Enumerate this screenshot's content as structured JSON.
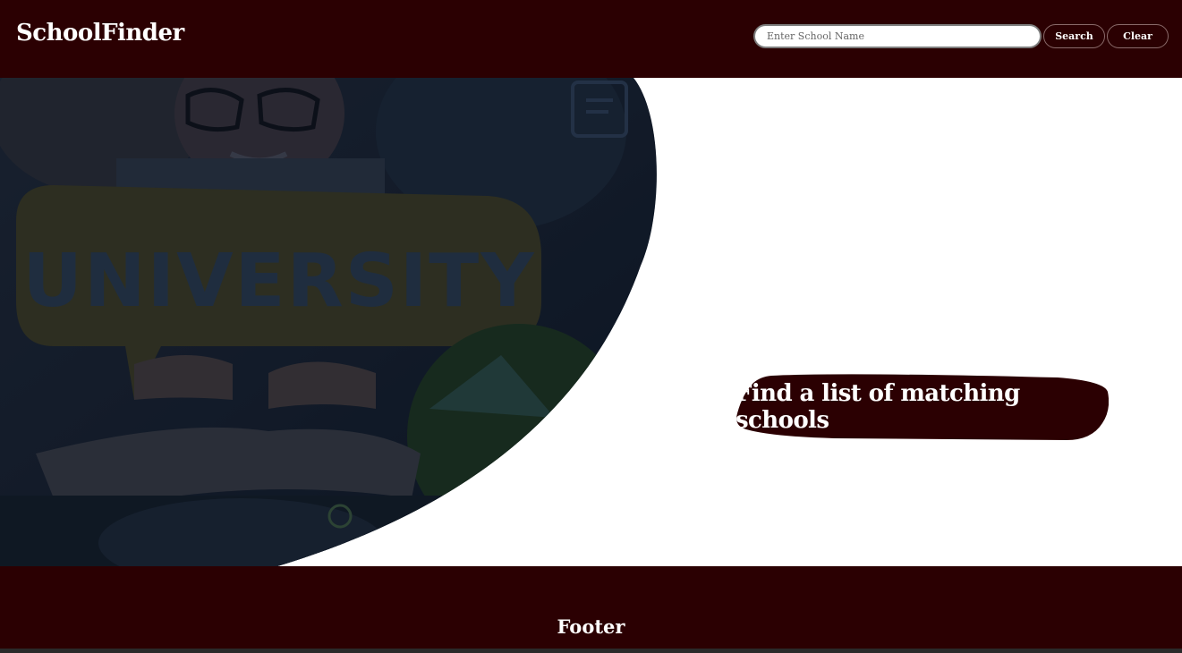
{
  "header": {
    "brand": "SchoolFinder",
    "search": {
      "placeholder": "Enter School Name",
      "value": ""
    },
    "search_label": "Search",
    "clear_label": "Clear"
  },
  "hero": {
    "image_text": "UNIVERSITY",
    "cta_label": "Find a list of matching schools"
  },
  "footer": {
    "label": "Footer"
  },
  "colors": {
    "primary": "#2b0002",
    "surface": "#ffffff",
    "image_overlay": "#0d1a2b"
  }
}
